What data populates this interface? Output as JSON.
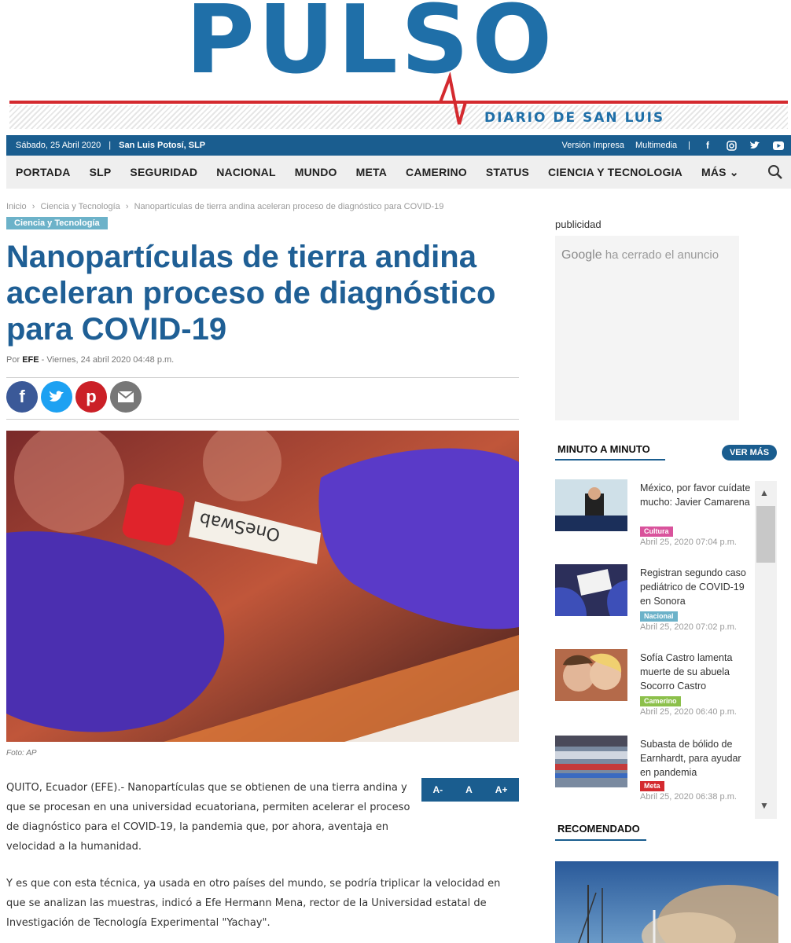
{
  "brand": {
    "name": "PULSO",
    "tagline": "DIARIO DE SAN LUIS",
    "primary_color": "#1f6fa8",
    "accent_color": "#d42a2f"
  },
  "topbar": {
    "date": "Sábado, 25 Abril 2020",
    "separator": "|",
    "location": "San Luis Potosí, SLP",
    "links": [
      "Versión Impresa",
      "Multimedia"
    ],
    "social_icons": [
      "facebook-icon",
      "instagram-icon",
      "twitter-icon",
      "youtube-icon"
    ]
  },
  "nav": {
    "items": [
      "PORTADA",
      "SLP",
      "SEGURIDAD",
      "NACIONAL",
      "MUNDO",
      "META",
      "CAMERINO",
      "STATUS",
      "CIENCIA Y TECNOLOGIA",
      "MÁS ⌄"
    ],
    "search_icon": "search-icon"
  },
  "breadcrumb": [
    "Inicio",
    "›",
    "Ciencia y Tecnología",
    "›",
    "Nanopartículas de tierra andina aceleran proceso de diagnóstico para COVID-19"
  ],
  "article": {
    "category": "Ciencia y Tecnología",
    "title": "Nanopartículas de tierra andina aceleran proceso de diagnóstico para COVID-19",
    "byline_prefix": "Por",
    "author": "EFE",
    "date": "- Viernes, 24 abril 2020 04:48 p.m.",
    "share_icons": [
      "facebook-icon",
      "twitter-icon",
      "pinterest-icon",
      "email-icon"
    ],
    "photo_credit": "Foto: AP",
    "photo_label": "OneSwab",
    "font_sizer": [
      "A-",
      "A",
      "A+"
    ],
    "paragraphs": [
      "QUITO, Ecuador (EFE).- Nanopartículas que se obtienen de una tierra andina y que se procesan en una universidad ecuatoriana, permiten acelerar el proceso de diagnóstico para el COVID-19, la pandemia que, por ahora, aventaja en velocidad a la humanidad.",
      "Y es que con esta técnica, ya usada en otro países del mundo, se podría triplicar la velocidad en que se analizan las muestras, indicó a Efe Hermann Mena, rector de la Universidad estatal de Investigación de Tecnología Experimental \"Yachay\"."
    ]
  },
  "sidebar": {
    "publicidad_label": "publicidad",
    "ad": {
      "google": "Google",
      "message": "ha cerrado el anuncio"
    },
    "minuto": {
      "title": "MINUTO A MINUTO",
      "ver_mas": "VER MÁS",
      "items": [
        {
          "title": "México, por favor cuídate mucho: Javier Camarena",
          "tag": "Cultura",
          "tag_color": "#d9539c",
          "date": "Abril 25, 2020 07:04 p.m."
        },
        {
          "title": "Registran segundo caso pediátrico de COVID-19 en Sonora",
          "tag": "Nacional",
          "tag_color": "#6cb2c9",
          "date": "Abril 25, 2020 07:02 p.m."
        },
        {
          "title": "Sofía Castro lamenta muerte de su abuela Socorro Castro",
          "tag": "Camerino",
          "tag_color": "#8cc04b",
          "date": "Abril 25, 2020 06:40 p.m."
        },
        {
          "title": "Subasta de bólido de Earnhardt, para ayudar en pandemia",
          "tag": "Meta",
          "tag_color": "#d42a2f",
          "date": "Abril 25, 2020 06:38 p.m."
        }
      ]
    },
    "recomendado": {
      "title": "RECOMENDADO"
    }
  }
}
